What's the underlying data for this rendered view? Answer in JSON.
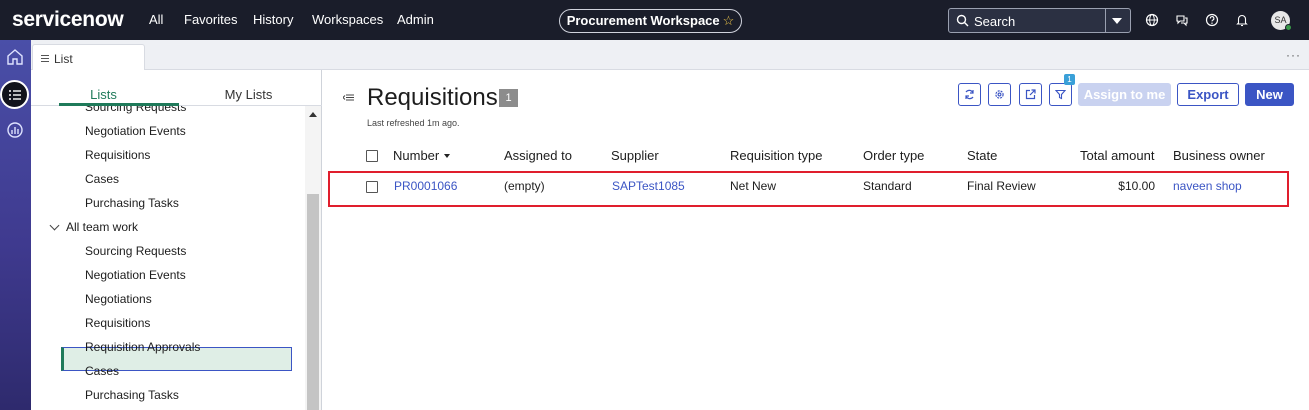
{
  "topnav": {
    "logo": "servicenow",
    "links": [
      "All",
      "Favorites",
      "History",
      "Workspaces",
      "Admin"
    ],
    "workspace_title": "Procurement Workspace",
    "search_placeholder": "Search",
    "avatar_initials": "SA"
  },
  "tabs": {
    "active_tab": "List",
    "more": "···"
  },
  "left_panel": {
    "tab_lists": "Lists",
    "tab_my_lists": "My Lists",
    "items_top": [
      "Sourcing Requests",
      "Negotiation Events",
      "Requisitions",
      "Cases",
      "Purchasing Tasks"
    ],
    "group_label": "All team work",
    "items_group": [
      "Sourcing Requests",
      "Negotiation Events",
      "Negotiations",
      "Requisitions",
      "Requisition Approvals",
      "Cases",
      "Purchasing Tasks"
    ],
    "selected_item": "Requisitions"
  },
  "main": {
    "title": "Requisitions",
    "count": "1",
    "last_refreshed": "Last refreshed 1m ago.",
    "filter_count": "1",
    "buttons": {
      "assign": "Assign to me",
      "export": "Export",
      "new": "New"
    },
    "columns": [
      "Number",
      "Assigned to",
      "Supplier",
      "Requisition type",
      "Order type",
      "State",
      "Total amount",
      "Business owner"
    ],
    "rows": [
      {
        "number": "PR0001066",
        "assigned_to": "(empty)",
        "supplier": "SAPTest1085",
        "requisition_type": "Net New",
        "order_type": "Standard",
        "state": "Final Review",
        "total_amount": "$10.00",
        "business_owner": "naveen shop"
      }
    ]
  },
  "colors": {
    "nav_bg": "#1a1d2a",
    "accent_blue": "#3b55c4",
    "accent_green": "#1f7a5a",
    "highlight_red": "#e01e2d"
  }
}
